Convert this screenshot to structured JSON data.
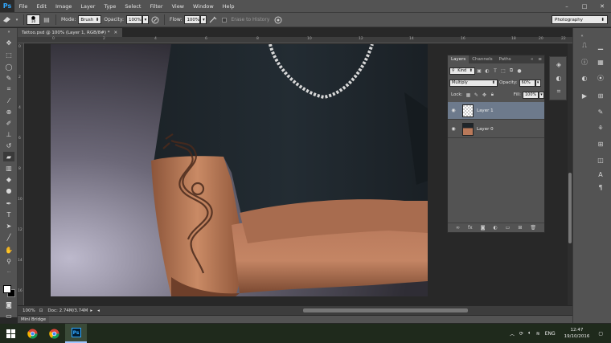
{
  "app": {
    "logo": "Ps"
  },
  "menu": [
    "File",
    "Edit",
    "Image",
    "Layer",
    "Type",
    "Select",
    "Filter",
    "View",
    "Window",
    "Help"
  ],
  "window_controls": [
    "–",
    "□",
    "✕"
  ],
  "options": {
    "brush_size": "10",
    "mode_label": "Mode:",
    "mode_value": "Brush",
    "opacity_label": "Opacity:",
    "opacity_value": "100%",
    "flow_label": "Flow:",
    "flow_value": "100%",
    "erase_history_label": "Erase to History",
    "workspace": "Photography"
  },
  "document": {
    "tab_label": "Tattoo.psd @ 100% (Layer 1, RGB/8#) *",
    "tab_close": "✕"
  },
  "status": {
    "zoom": "100%",
    "doc_size": "Doc: 2.74M/3.74M"
  },
  "mini_bridge": {
    "label": "Mini Bridge"
  },
  "layers_panel": {
    "tabs": [
      "Layers",
      "Channels",
      "Paths"
    ],
    "active_tab": "Layers",
    "filter_label": "Kind",
    "blend_mode": "Multiply",
    "opacity_label": "Opacity:",
    "opacity_value": "60%",
    "lock_label": "Lock:",
    "fill_label": "Fill:",
    "fill_value": "100%",
    "layers": [
      {
        "name": "Layer 1",
        "selected": true
      },
      {
        "name": "Layer 0",
        "selected": false
      }
    ]
  },
  "rulers": {
    "top_ticks": [
      "0",
      "2",
      "4",
      "6",
      "8",
      "10",
      "12",
      "14",
      "16",
      "18",
      "20",
      "22"
    ],
    "left_ticks": [
      "0",
      "2",
      "4",
      "6",
      "8",
      "10",
      "12",
      "14",
      "16"
    ]
  },
  "taskbar": {
    "language": "ENG",
    "time": "12:47",
    "date": "19/10/2016"
  },
  "colors": {
    "ui_panel": "#535353",
    "ui_dark": "#282828",
    "selected_layer": "#6d7a8c",
    "brand_blue": "#31a8ff",
    "taskbar": "#1f2a1c"
  }
}
